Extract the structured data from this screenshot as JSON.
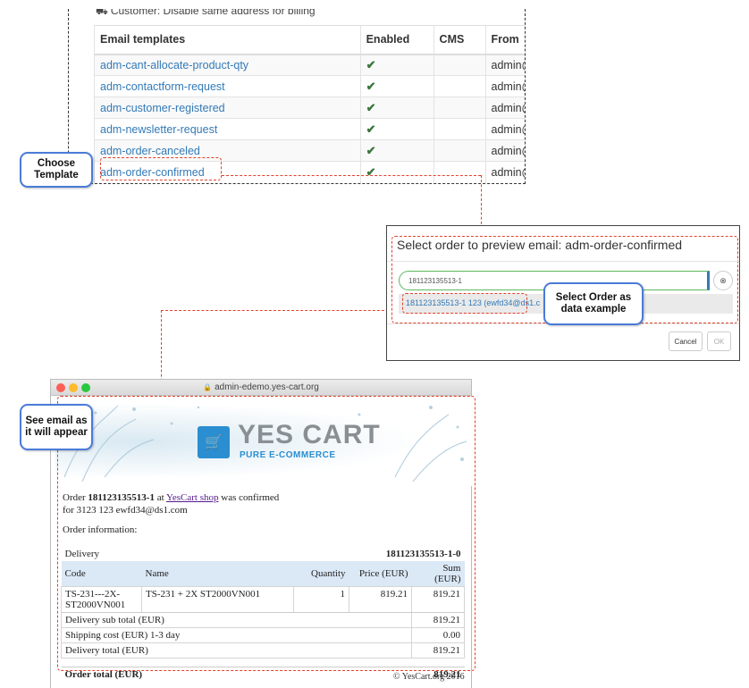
{
  "templates_panel": {
    "header_note": "Customer: Disable same address for billing",
    "columns": [
      "Email templates",
      "Enabled",
      "CMS",
      "From"
    ],
    "rows": [
      {
        "name": "adm-cant-allocate-product-qty",
        "enabled": "✔",
        "cms": "",
        "from": "admin@"
      },
      {
        "name": "adm-contactform-request",
        "enabled": "✔",
        "cms": "",
        "from": "admin@"
      },
      {
        "name": "adm-customer-registered",
        "enabled": "✔",
        "cms": "",
        "from": "admin@"
      },
      {
        "name": "adm-newsletter-request",
        "enabled": "✔",
        "cms": "",
        "from": "admin@"
      },
      {
        "name": "adm-order-canceled",
        "enabled": "✔",
        "cms": "",
        "from": "admin@"
      },
      {
        "name": "adm-order-confirmed",
        "enabled": "✔",
        "cms": "",
        "from": "admin@"
      }
    ]
  },
  "callouts": {
    "choose_template": "Choose Template",
    "select_order": "Select Order as data example",
    "see_email": "See email as it will appear"
  },
  "dialog": {
    "title": "Select order to preview email: adm-order-confirmed",
    "input_value": "181123135513-1",
    "clear_icon": "⊗",
    "suggestion": "181123135513-1 123 (ewfd34@ds1.c",
    "cancel_label": "Cancel",
    "ok_label": "OK"
  },
  "browser": {
    "url": "admin-edemo.yes-cart.org"
  },
  "email": {
    "logo_main": "YES CART",
    "logo_sub": "PURE E-COMMERCE",
    "line1_prefix": "Order",
    "order_number": "181123135513-1",
    "line1_mid": "at",
    "shop_link": "YesCart shop",
    "line1_suffix": "was confirmed",
    "line2": "for 3123 123 ewfd34@ds1.com",
    "info_label": "Order information:",
    "delivery_label": "Delivery",
    "delivery_number": "181123135513-1-0",
    "columns": [
      "Code",
      "Name",
      "Quantity",
      "Price (EUR)",
      "Sum (EUR)"
    ],
    "item": {
      "code": "TS-231---2X-ST2000VN001",
      "name": "TS-231 + 2X ST2000VN001",
      "qty": "1",
      "price": "819.21",
      "sum": "819.21"
    },
    "sub_total_label": "Delivery sub total (EUR)",
    "sub_total": "819.21",
    "shipping_label": "Shipping cost (EUR) 1-3 day",
    "shipping": "0.00",
    "delivery_total_label": "Delivery total (EUR)",
    "delivery_total": "819.21",
    "order_total_label": "Order total (EUR)",
    "order_total": "819.21",
    "footer": "© YesCart.org 2016"
  },
  "colors": {
    "link_blue": "#337ab7",
    "check_green": "#3c763d",
    "highlight_red": "#e0412b",
    "callout_blue": "#4a7bd9"
  }
}
